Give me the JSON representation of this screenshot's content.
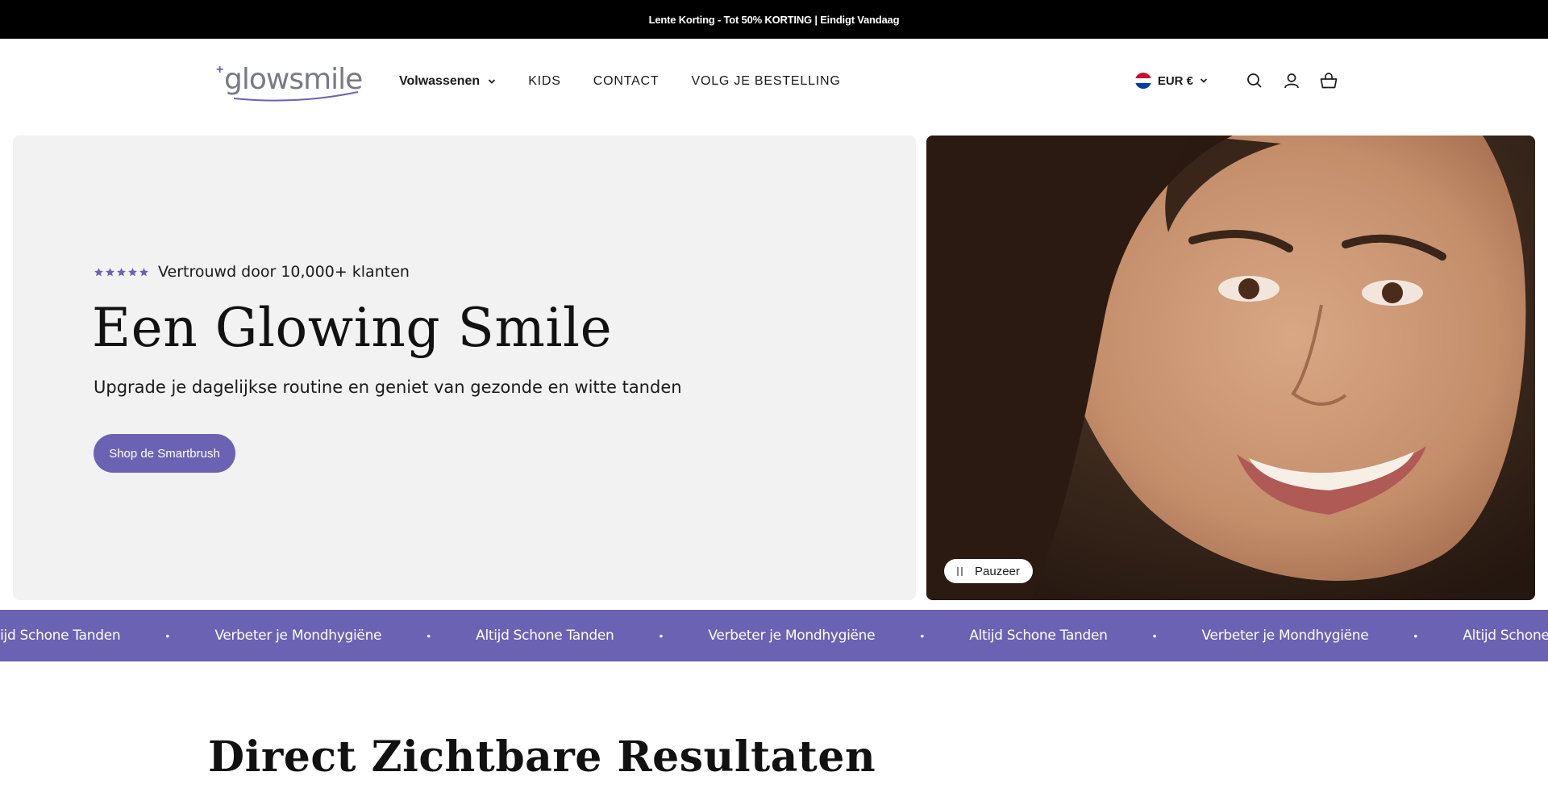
{
  "announcement": {
    "text": "Lente Korting - Tot 50% KORTING | Eindigt Vandaag"
  },
  "header": {
    "logo_text": "glowsmile",
    "nav": [
      {
        "label": "Volwassenen",
        "has_dropdown": true
      },
      {
        "label": "KIDS"
      },
      {
        "label": "CONTACT"
      },
      {
        "label": "VOLG JE BESTELLING"
      }
    ],
    "currency": {
      "label": "EUR €",
      "flag": "netherlands-flag"
    },
    "icons": [
      "search-icon",
      "account-icon",
      "cart-icon"
    ]
  },
  "hero": {
    "rating_stars": 5,
    "rating_text": "Vertrouwd door 10,000+ klanten",
    "title": "Een Glowing Smile",
    "subtitle": "Upgrade je dagelijkse routine en geniet van gezonde en witte tanden",
    "cta_label": "Shop de Smartbrush",
    "pause_label": "Pauzeer"
  },
  "marquee": {
    "items": [
      "Altijd Schone Tanden",
      "Verbeter je Mondhygiëne",
      "Altijd Schone Tanden",
      "Verbeter je Mondhygiëne",
      "Altijd Schone Tanden",
      "Verbeter je Mondhygiëne",
      "Altijd Schone Tanden"
    ],
    "separator": "•"
  },
  "section": {
    "title": "Direct Zichtbare Resultaten"
  },
  "colors": {
    "brand": "#6b62b4",
    "announcement_bg": "#000000",
    "hero_bg": "#f2f2f2"
  }
}
